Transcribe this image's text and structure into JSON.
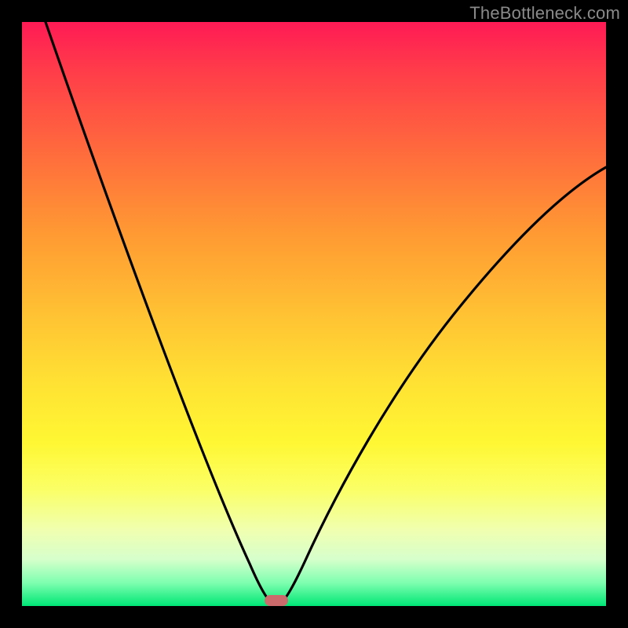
{
  "watermark": "TheBottleneck.com",
  "chart_data": {
    "type": "line",
    "title": "",
    "xlabel": "",
    "ylabel": "",
    "xlim": [
      0,
      100
    ],
    "ylim": [
      0,
      100
    ],
    "grid": false,
    "legend": false,
    "background": "rainbow-gradient (red top to green bottom)",
    "series": [
      {
        "name": "left-branch",
        "x": [
          4,
          8,
          12,
          16,
          20,
          24,
          28,
          32,
          36,
          38,
          40,
          41,
          42,
          43
        ],
        "y": [
          100,
          90,
          79,
          68,
          57,
          46,
          35,
          25,
          15,
          10,
          5,
          3,
          1,
          0
        ]
      },
      {
        "name": "right-branch",
        "x": [
          44,
          45,
          46,
          48,
          52,
          56,
          62,
          70,
          80,
          90,
          100
        ],
        "y": [
          0,
          1,
          3,
          6,
          12,
          19,
          29,
          41,
          54,
          65,
          75
        ]
      }
    ],
    "annotations": [
      {
        "name": "optimal-marker",
        "shape": "rounded-rect",
        "x": 43.5,
        "y": 0,
        "color": "#cc6b6b"
      }
    ]
  }
}
